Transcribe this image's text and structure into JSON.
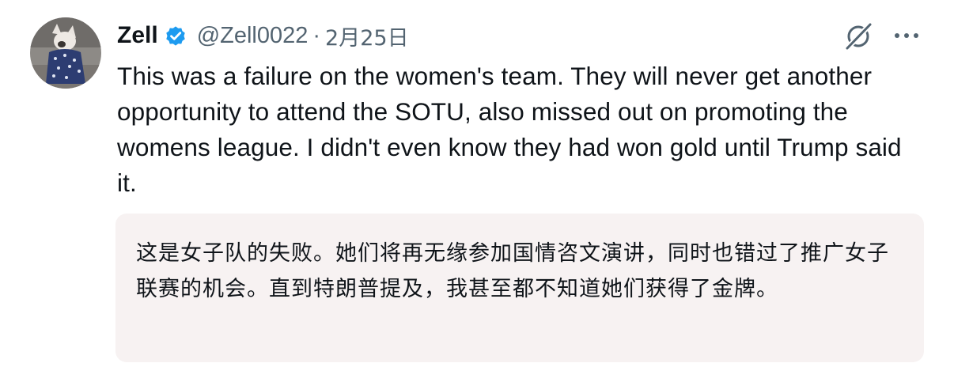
{
  "author": {
    "display_name": "Zell",
    "handle": "@Zell0022",
    "separator": "·",
    "timestamp": "2月25日",
    "verified_badge_color": "#1d9bf0"
  },
  "tweet": {
    "text": "This was a failure on the women's team. They will never get another opportunity to attend the SOTU, also missed out on promoting the womens league. I didn't even know they had won gold until Trump said it."
  },
  "translation": {
    "text": "这是女子队的失败。她们将再无缘参加国情咨文演讲，同时也错过了推广女子联赛的机会。直到特朗普提及，我甚至都不知道她们获得了金牌。",
    "background_color": "#f7f2f2"
  },
  "icons": {
    "avatar": "avatar-image",
    "verified": "verified-badge-icon",
    "grok": "grok-icon",
    "more": "more-options-icon"
  }
}
